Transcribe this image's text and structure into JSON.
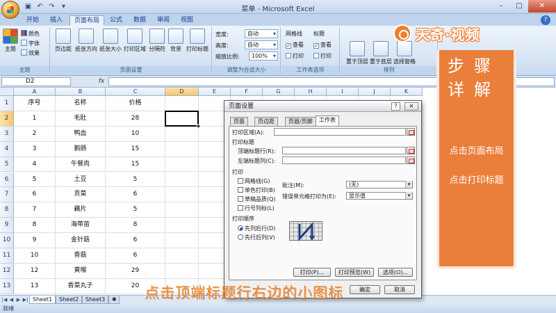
{
  "window": {
    "title": "菜单 - Microsoft Excel",
    "controls": [
      "–",
      "□",
      "✕"
    ]
  },
  "tabs": [
    "开始",
    "插入",
    "页面布局",
    "公式",
    "数据",
    "审阅",
    "视图"
  ],
  "ribbon": {
    "theme_group": {
      "label": "主题",
      "big": "主题",
      "small": [
        "颜色",
        "字体",
        "效果"
      ]
    },
    "page_setup_group": {
      "label": "页面设置",
      "buttons": [
        "页边距",
        "纸张方向",
        "纸张大小",
        "打印区域",
        "分隔符",
        "背景",
        "打印标题"
      ]
    },
    "scale_group": {
      "label": "调整为合适大小",
      "rows": [
        {
          "label": "宽度:",
          "value": "自动"
        },
        {
          "label": "高度:",
          "value": "自动"
        },
        {
          "label": "缩放比例:",
          "value": "100%"
        }
      ]
    },
    "sheet_options_group": {
      "label": "工作表选项",
      "col1_title": "网格线",
      "col2_title": "标题",
      "view": "查看",
      "print": "打印"
    },
    "arrange_group": {
      "label": "排列",
      "buttons": [
        "置于顶层",
        "置于底层",
        "选择窗格"
      ]
    }
  },
  "formula_bar": {
    "name_box": "D2",
    "fx": "fx",
    "value": ""
  },
  "grid": {
    "columns": [
      "A",
      "B",
      "C",
      "D",
      "E",
      "F",
      "G",
      "H",
      "I",
      "J",
      "K"
    ],
    "row_numbers": [
      "1",
      "2",
      "3",
      "4",
      "5",
      "6",
      "7",
      "8",
      "9",
      "10",
      "11",
      "12",
      "13"
    ],
    "rows": [
      [
        "序号",
        "名称",
        "价格"
      ],
      [
        "1",
        "毛肚",
        "28"
      ],
      [
        "2",
        "鸭血",
        "10"
      ],
      [
        "3",
        "鹅肠",
        "15"
      ],
      [
        "4",
        "午餐肉",
        "15"
      ],
      [
        "5",
        "土豆",
        "5"
      ],
      [
        "6",
        "贡菜",
        "6"
      ],
      [
        "7",
        "藕片",
        "5"
      ],
      [
        "8",
        "海带苗",
        "8"
      ],
      [
        "9",
        "金针菇",
        "6"
      ],
      [
        "10",
        "香菇",
        "6"
      ],
      [
        "12",
        "黄喉",
        "29"
      ],
      [
        "13",
        "香菜丸子",
        "20"
      ]
    ]
  },
  "sheets": [
    "Sheet1",
    "Sheet2",
    "Sheet3"
  ],
  "status": "就绪",
  "dialog": {
    "title": "页面设置",
    "help": "?",
    "close": "✕",
    "tabs": [
      "页面",
      "页边距",
      "页眉/页脚",
      "工作表"
    ],
    "print_area_label": "打印区域(A):",
    "print_titles_label": "打印标题",
    "top_rows_label": "顶端标题行(R):",
    "left_cols_label": "左端标题列(C):",
    "print_section_label": "打印",
    "checkboxes": [
      "网格线(G)",
      "单色打印(B)",
      "草稿品质(Q)",
      "行号列标(L)"
    ],
    "comments_label": "批注(M):",
    "comments_value": "(无)",
    "errors_label": "错误单元格打印为(E):",
    "errors_value": "显示值",
    "order_label": "打印顺序",
    "order_options": [
      "先列后行(D)",
      "先行后列(V)"
    ],
    "buttons": [
      "打印(P)...",
      "打印预览(W)",
      "选项(O)...",
      "确定",
      "取消"
    ]
  },
  "overlay": {
    "brand": "天奇·视频",
    "steps_title": "步骤详解",
    "steps": [
      "点击页面布局",
      "点击打印标题"
    ],
    "caption": "点击顶端标题行右边的小图标"
  }
}
